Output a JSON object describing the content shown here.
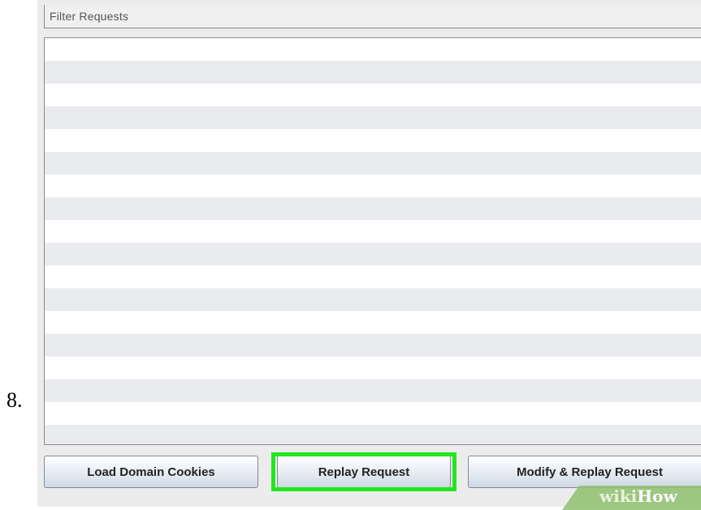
{
  "step": {
    "number": "8."
  },
  "filter": {
    "label": "Filter Requests"
  },
  "requests": {
    "rows": [
      "",
      "",
      "",
      "",
      "",
      "",
      "",
      "",
      "",
      "",
      "",
      "",
      "",
      "",
      "",
      "",
      "",
      ""
    ]
  },
  "buttons": {
    "load_domain_cookies": "Load Domain Cookies",
    "replay_request": "Replay Request",
    "modify_replay_request": "Modify & Replay Request"
  },
  "highlight": {
    "color": "#22e61e",
    "target": "replay_request"
  },
  "watermark": {
    "part1": "wiki",
    "part2": "How"
  }
}
